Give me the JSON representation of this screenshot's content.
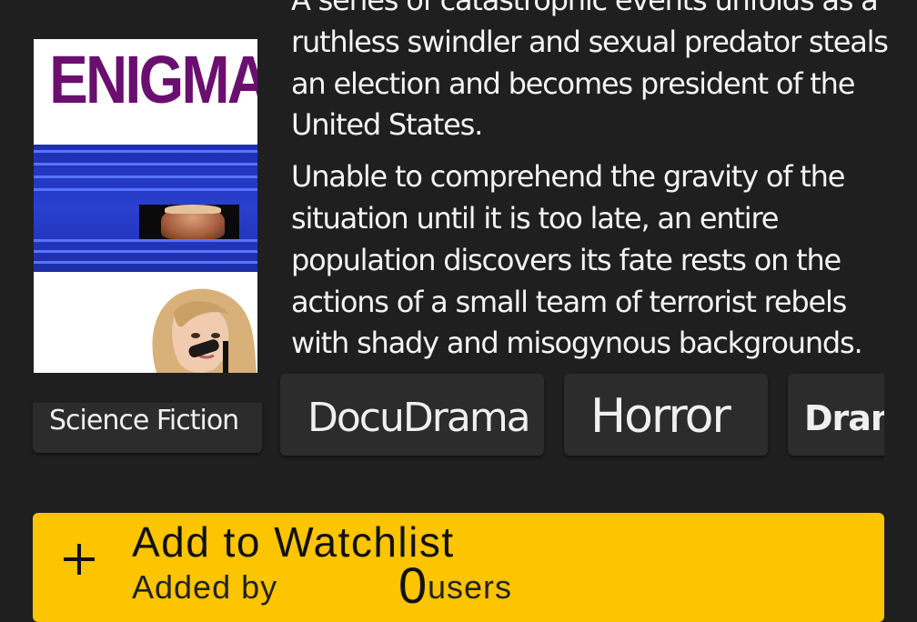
{
  "poster": {
    "title": "ENIGMA",
    "title_color": "#6a0f6f",
    "blinds_color": "#2940cf"
  },
  "synopsis": {
    "paragraph_1": "A series of catastrophic events unfolds as a ruthless swindler and sexual predator steals an election and becomes president of the United States.",
    "paragraph_2": "Unable to comprehend the gravity of the situation until it is too late, an entire population discovers its fate rests on the actions of a small team of terrorist rebels with shady and misogynous backgrounds."
  },
  "genres": [
    {
      "label": "Science Fiction"
    },
    {
      "label": "DocuDrama"
    },
    {
      "label": "Horror"
    },
    {
      "label": "Drama"
    }
  ],
  "watchlist": {
    "icon": "plus-icon",
    "label": "Add to Watchlist",
    "added_by_label": "Added by",
    "count": "0",
    "users_label": "users",
    "color": "#fdc400"
  },
  "colors": {
    "background": "#1f1f1f",
    "chip": "#2c2c2c",
    "accent": "#fdc400"
  }
}
